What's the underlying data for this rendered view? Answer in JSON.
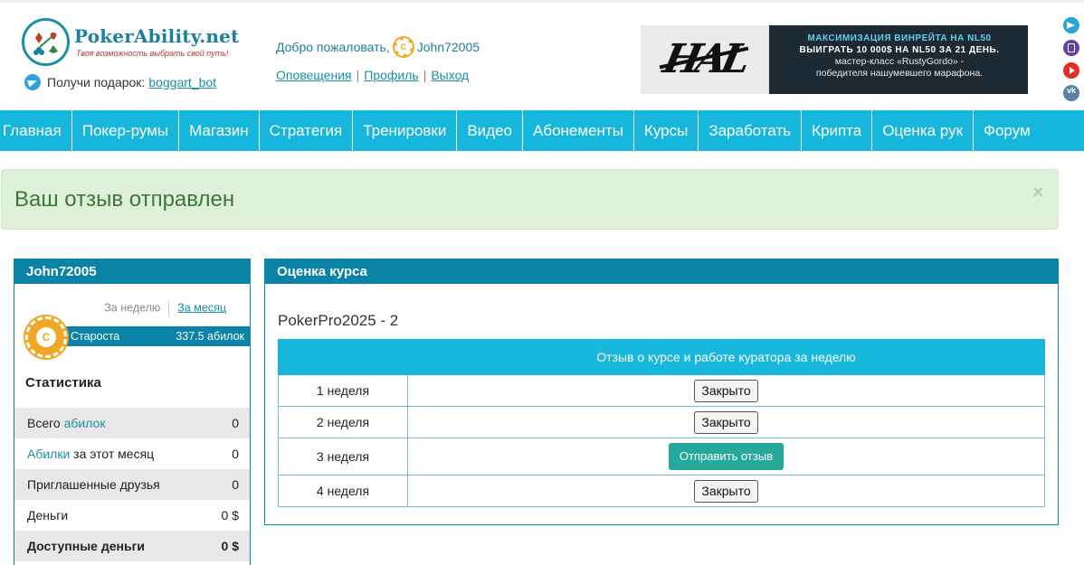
{
  "header": {
    "logo_name": "PokerAbility",
    "logo_tld": ".net",
    "logo_tagline": "Твоя возможность выбрать свой путь!",
    "gift_label": "Получи подарок:",
    "gift_link": "boggart_bot",
    "welcome_text": "Добро пожаловать,",
    "username": "John72005",
    "links": [
      "Оповещения",
      "Профиль",
      "Выход"
    ],
    "link_separator": "|"
  },
  "banner": {
    "line1": "МАКСИМИЗАЦИЯ ВИНРЕЙТА НА NL50",
    "line2": "ВЫИГРАТЬ 10 000$ НА NL50 ЗА 21 ДЕНЬ.",
    "line3": "мастер-класс «RustyGordo» -",
    "line4": "победителя нашумевшего марафона."
  },
  "socials": [
    "telegram-icon",
    "twitch-icon",
    "youtube-icon",
    "vk-icon"
  ],
  "nav": {
    "items": [
      "Главная",
      "Покер-румы",
      "Магазин",
      "Стратегия",
      "Тренировки",
      "Видео",
      "Абонементы",
      "Курсы",
      "Заработать",
      "Крипта",
      "Оценка рук",
      "Форум"
    ]
  },
  "alert": {
    "message": "Ваш отзыв отправлен",
    "close": "×"
  },
  "sidebar": {
    "title": "John72005",
    "period_week": "За неделю",
    "period_month": "За месяц",
    "coin_letter": "C",
    "rank_name": "Староста",
    "rank_value": "337.5 абилок",
    "stats_title": "Статистика",
    "stats": [
      {
        "label_pre": "Всего ",
        "label_hl": "абилок",
        "label_post": "",
        "value": "0"
      },
      {
        "label_pre": "",
        "label_hl": "Абилки",
        "label_post": " за этот месяц",
        "value": "0"
      },
      {
        "label_pre": "Приглашенные друзья",
        "label_hl": "",
        "label_post": "",
        "value": "0"
      },
      {
        "label_pre": "Деньги",
        "label_hl": "",
        "label_post": "",
        "value": "0 $"
      },
      {
        "label_pre": "Доступные деньги",
        "label_hl": "",
        "label_post": "",
        "value": "0 $"
      }
    ]
  },
  "main": {
    "panel_title": "Оценка курса",
    "course_title": "PokerPro2025 - 2",
    "table_header_week": "",
    "table_header": "Отзыв о курсе и работе куратора за неделю",
    "rows": [
      {
        "week": "1 неделя",
        "action": "Закрыто",
        "type": "closed"
      },
      {
        "week": "2 неделя",
        "action": "Закрыто",
        "type": "closed"
      },
      {
        "week": "3 неделя",
        "action": "Отправить отзыв",
        "type": "send"
      },
      {
        "week": "4 неделя",
        "action": "Закрыто",
        "type": "closed"
      }
    ]
  },
  "colors": {
    "nav_bg": "#16b6dd",
    "panel_head": "#0a83a6",
    "alert_bg": "#dff0d8",
    "alert_text": "#3c763d",
    "send_button": "#26a99a",
    "coin": "#f0a824"
  }
}
